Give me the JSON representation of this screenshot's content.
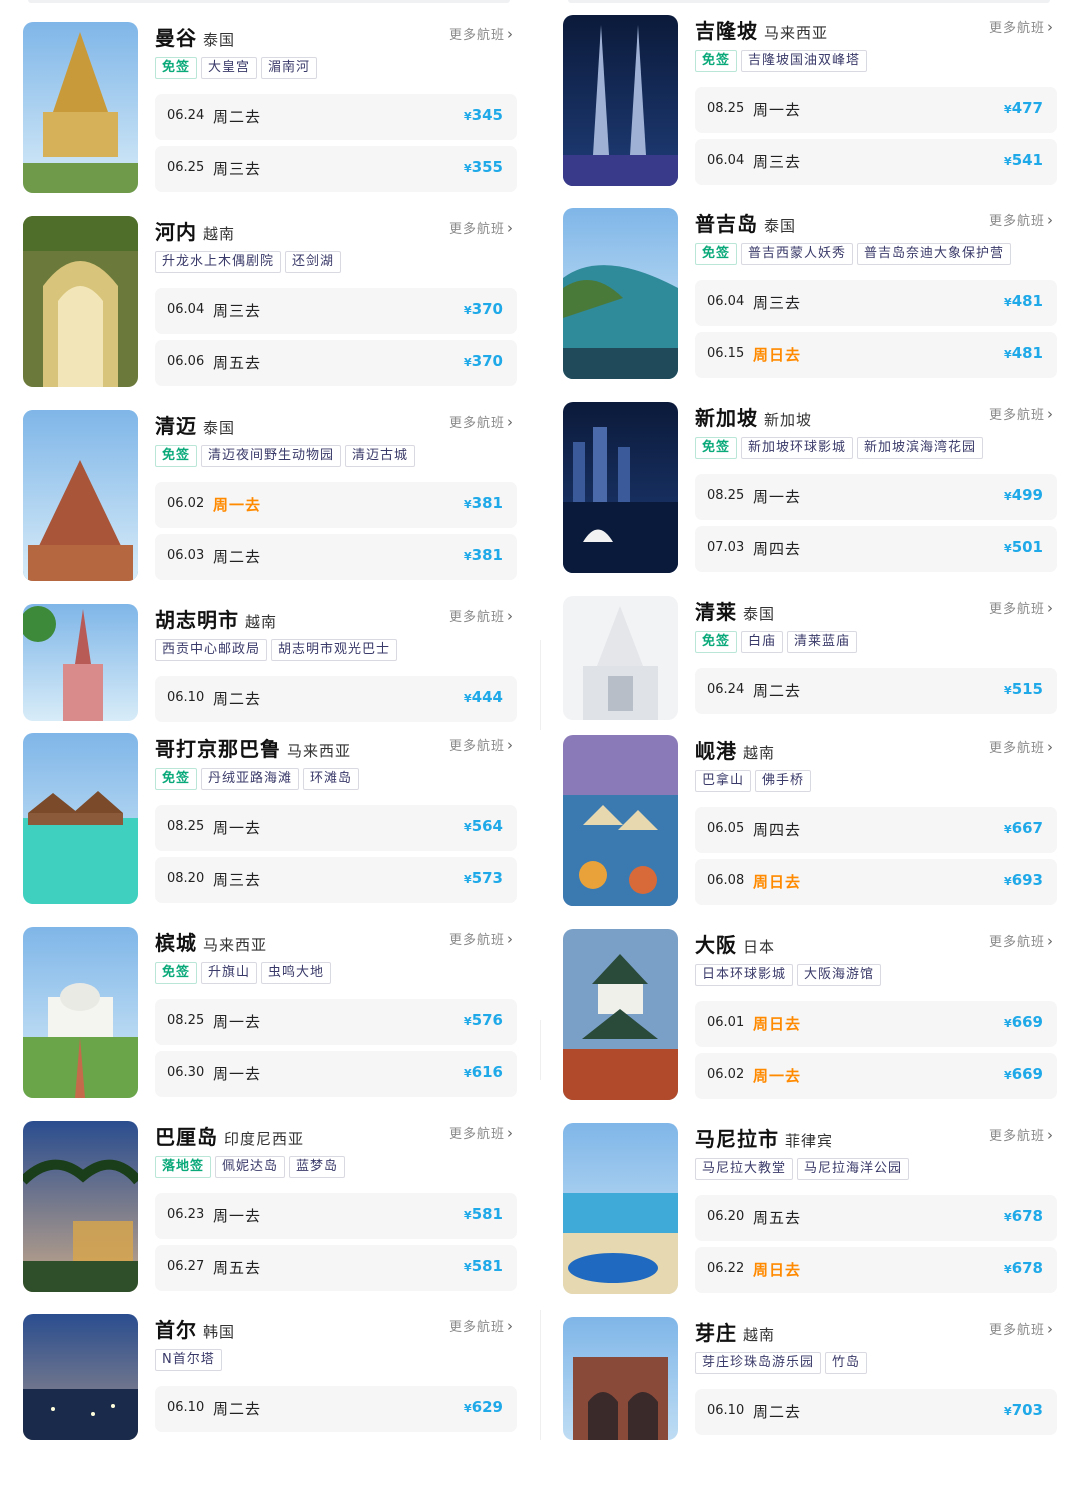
{
  "more_label": "更多航班",
  "currency": "¥",
  "left": [
    {
      "city": "曼谷",
      "country": "泰国",
      "tags": [
        {
          "text": "免签",
          "visa": true
        },
        {
          "text": "大皇宫"
        },
        {
          "text": "湄南河"
        }
      ],
      "flights": [
        {
          "date": "06.24",
          "day": "周二去",
          "price": "345"
        },
        {
          "date": "06.25",
          "day": "周三去",
          "price": "355"
        }
      ]
    },
    {
      "city": "河内",
      "country": "越南",
      "tags": [
        {
          "text": "升龙水上木偶剧院"
        },
        {
          "text": "还剑湖"
        }
      ],
      "flights": [
        {
          "date": "06.04",
          "day": "周三去",
          "price": "370"
        },
        {
          "date": "06.06",
          "day": "周五去",
          "price": "370"
        }
      ]
    },
    {
      "city": "清迈",
      "country": "泰国",
      "tags": [
        {
          "text": "免签",
          "visa": true
        },
        {
          "text": "清迈夜间野生动物园"
        },
        {
          "text": "清迈古城"
        }
      ],
      "flights": [
        {
          "date": "06.02",
          "day": "周一去",
          "price": "381",
          "hl": true
        },
        {
          "date": "06.03",
          "day": "周二去",
          "price": "381"
        }
      ]
    },
    {
      "city": "胡志明市",
      "country": "越南",
      "tags": [
        {
          "text": "西贡中心邮政局"
        },
        {
          "text": "胡志明市观光巴士"
        }
      ],
      "flights": [
        {
          "date": "06.10",
          "day": "周二去",
          "price": "444"
        }
      ]
    },
    {
      "city": "哥打京那巴鲁",
      "country": "马来西亚",
      "tags": [
        {
          "text": "免签",
          "visa": true
        },
        {
          "text": "丹绒亚路海滩"
        },
        {
          "text": "环滩岛"
        }
      ],
      "flights": [
        {
          "date": "08.25",
          "day": "周一去",
          "price": "564"
        },
        {
          "date": "08.20",
          "day": "周三去",
          "price": "573"
        }
      ]
    },
    {
      "city": "槟城",
      "country": "马来西亚",
      "tags": [
        {
          "text": "免签",
          "visa": true
        },
        {
          "text": "升旗山"
        },
        {
          "text": "虫鸣大地"
        }
      ],
      "flights": [
        {
          "date": "08.25",
          "day": "周一去",
          "price": "576"
        },
        {
          "date": "06.30",
          "day": "周一去",
          "price": "616"
        }
      ]
    },
    {
      "city": "巴厘岛",
      "country": "印度尼西亚",
      "tags": [
        {
          "text": "落地签",
          "visa": true
        },
        {
          "text": "佩妮达岛"
        },
        {
          "text": "蓝梦岛"
        }
      ],
      "flights": [
        {
          "date": "06.23",
          "day": "周一去",
          "price": "581"
        },
        {
          "date": "06.27",
          "day": "周五去",
          "price": "581"
        }
      ]
    },
    {
      "city": "首尔",
      "country": "韩国",
      "tags": [
        {
          "text": "N首尔塔"
        }
      ],
      "flights": [
        {
          "date": "06.10",
          "day": "周二去",
          "price": "629"
        }
      ]
    }
  ],
  "right": [
    {
      "city": "吉隆坡",
      "country": "马来西亚",
      "tags": [
        {
          "text": "免签",
          "visa": true
        },
        {
          "text": "吉隆坡国油双峰塔"
        }
      ],
      "flights": [
        {
          "date": "08.25",
          "day": "周一去",
          "price": "477"
        },
        {
          "date": "06.04",
          "day": "周三去",
          "price": "541"
        }
      ]
    },
    {
      "city": "普吉岛",
      "country": "泰国",
      "tags": [
        {
          "text": "免签",
          "visa": true
        },
        {
          "text": "普吉西蒙人妖秀"
        },
        {
          "text": "普吉岛奈迪大象保护营"
        }
      ],
      "flights": [
        {
          "date": "06.04",
          "day": "周三去",
          "price": "481"
        },
        {
          "date": "06.15",
          "day": "周日去",
          "price": "481",
          "hl": true
        }
      ]
    },
    {
      "city": "新加坡",
      "country": "新加坡",
      "tags": [
        {
          "text": "免签",
          "visa": true
        },
        {
          "text": "新加坡环球影城"
        },
        {
          "text": "新加坡滨海湾花园"
        }
      ],
      "flights": [
        {
          "date": "08.25",
          "day": "周一去",
          "price": "499"
        },
        {
          "date": "07.03",
          "day": "周四去",
          "price": "501"
        }
      ]
    },
    {
      "city": "清莱",
      "country": "泰国",
      "tags": [
        {
          "text": "免签",
          "visa": true
        },
        {
          "text": "白庙"
        },
        {
          "text": "清莱蓝庙"
        }
      ],
      "flights": [
        {
          "date": "06.24",
          "day": "周二去",
          "price": "515"
        }
      ]
    },
    {
      "city": "岘港",
      "country": "越南",
      "tags": [
        {
          "text": "巴拿山"
        },
        {
          "text": "佛手桥"
        }
      ],
      "flights": [
        {
          "date": "06.05",
          "day": "周四去",
          "price": "667"
        },
        {
          "date": "06.08",
          "day": "周日去",
          "price": "693",
          "hl": true
        }
      ]
    },
    {
      "city": "大阪",
      "country": "日本",
      "tags": [
        {
          "text": "日本环球影城"
        },
        {
          "text": "大阪海游馆"
        }
      ],
      "flights": [
        {
          "date": "06.01",
          "day": "周日去",
          "price": "669",
          "hl": true
        },
        {
          "date": "06.02",
          "day": "周一去",
          "price": "669",
          "hl": true
        }
      ]
    },
    {
      "city": "马尼拉市",
      "country": "菲律宾",
      "tags": [
        {
          "text": "马尼拉大教堂"
        },
        {
          "text": "马尼拉海洋公园"
        }
      ],
      "flights": [
        {
          "date": "06.20",
          "day": "周五去",
          "price": "678"
        },
        {
          "date": "06.22",
          "day": "周日去",
          "price": "678",
          "hl": true
        }
      ]
    },
    {
      "city": "芽庄",
      "country": "越南",
      "tags": [
        {
          "text": "芽庄珍珠岛游乐园"
        },
        {
          "text": "竹岛"
        }
      ],
      "flights": [
        {
          "date": "06.10",
          "day": "周二去",
          "price": "703"
        }
      ]
    }
  ]
}
